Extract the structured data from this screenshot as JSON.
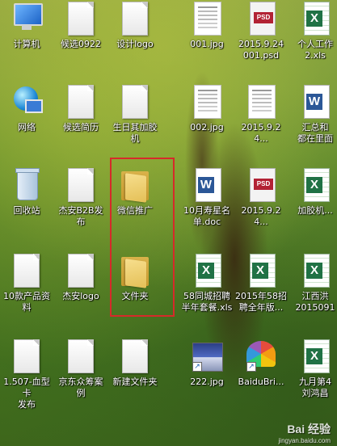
{
  "desktop": {
    "icons": [
      {
        "label": "计算机",
        "type": "computer"
      },
      {
        "label": "候选0922",
        "type": "doc"
      },
      {
        "label": "设计logo",
        "type": "doc"
      },
      {
        "label": "001.jpg",
        "type": "thumb"
      },
      {
        "label": "2015.9.24\n001.psd",
        "type": "psd"
      },
      {
        "label": "个人工作\n2.xls",
        "type": "excel"
      },
      {
        "label": "网络",
        "type": "network"
      },
      {
        "label": "候选简历",
        "type": "doc"
      },
      {
        "label": "生日其加胶\n机",
        "type": "doc"
      },
      {
        "label": "002.jpg",
        "type": "thumb"
      },
      {
        "label": "2015.9.24...",
        "type": "thumb"
      },
      {
        "label": "汇总和\n都在里面",
        "type": "word"
      },
      {
        "label": "回收站",
        "type": "bin"
      },
      {
        "label": "杰安B2B发布",
        "type": "doc"
      },
      {
        "label": "微信推广",
        "type": "folder"
      },
      {
        "label": "10月寿星名\n单.doc",
        "type": "word"
      },
      {
        "label": "2015.9.24...",
        "type": "psd"
      },
      {
        "label": "加胶机...",
        "type": "excel"
      },
      {
        "label": "10款产品资\n料",
        "type": "doc"
      },
      {
        "label": "杰安logo",
        "type": "doc"
      },
      {
        "label": "文件夹",
        "type": "folder"
      },
      {
        "label": "58同城招聘\n半年套餐.xls",
        "type": "excel"
      },
      {
        "label": "2015年58招\n聘全年版...",
        "type": "excel"
      },
      {
        "label": "江西洪\n2015091",
        "type": "excel"
      },
      {
        "label": "1.507-血型卡\n发布",
        "type": "doc"
      },
      {
        "label": "京东众筹案\n例",
        "type": "doc"
      },
      {
        "label": "新建文件夹",
        "type": "doc"
      },
      {
        "label": "222.jpg",
        "type": "photo"
      },
      {
        "label": "BaiduBri...",
        "type": "baidu"
      },
      {
        "label": "九月第4\n刘鸿昌",
        "type": "excel"
      }
    ]
  },
  "watermark": {
    "brand": "Bai 经验",
    "url": "jingyan.baidu.com"
  }
}
